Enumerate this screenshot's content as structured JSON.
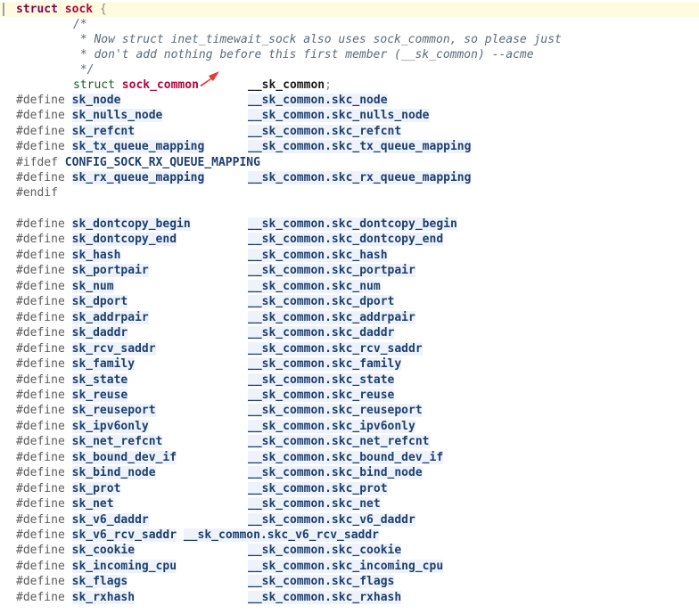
{
  "struct_line": {
    "keyword": "struct",
    "name": "sock",
    "brace": "{"
  },
  "comment_lines": [
    "/*",
    " * Now struct inet_timewait_sock also uses sock_common, so please just",
    " * don't add nothing before this first member (__sk_common) --acme",
    " */"
  ],
  "member": {
    "keyword": "struct",
    "type": "sock_common",
    "name": "__sk_common",
    "semi": ";"
  },
  "group1": [
    {
      "directive": "#define",
      "name": "sk_node",
      "value": "__sk_common.skc_node"
    },
    {
      "directive": "#define",
      "name": "sk_nulls_node",
      "value": "__sk_common.skc_nulls_node"
    },
    {
      "directive": "#define",
      "name": "sk_refcnt",
      "value": "__sk_common.skc_refcnt"
    },
    {
      "directive": "#define",
      "name": "sk_tx_queue_mapping",
      "value": "__sk_common.skc_tx_queue_mapping"
    }
  ],
  "ifdef": {
    "directive": "#ifdef",
    "name": "CONFIG_SOCK_RX_QUEUE_MAPPING"
  },
  "rx_define": {
    "directive": "#define",
    "name": "sk_rx_queue_mapping",
    "value": "__sk_common.skc_rx_queue_mapping"
  },
  "endif": "#endif",
  "group2": [
    {
      "directive": "#define",
      "name": "sk_dontcopy_begin",
      "value": "__sk_common.skc_dontcopy_begin"
    },
    {
      "directive": "#define",
      "name": "sk_dontcopy_end",
      "value": "__sk_common.skc_dontcopy_end"
    },
    {
      "directive": "#define",
      "name": "sk_hash",
      "value": "__sk_common.skc_hash"
    },
    {
      "directive": "#define",
      "name": "sk_portpair",
      "value": "__sk_common.skc_portpair"
    },
    {
      "directive": "#define",
      "name": "sk_num",
      "value": "__sk_common.skc_num"
    },
    {
      "directive": "#define",
      "name": "sk_dport",
      "value": "__sk_common.skc_dport"
    },
    {
      "directive": "#define",
      "name": "sk_addrpair",
      "value": "__sk_common.skc_addrpair"
    },
    {
      "directive": "#define",
      "name": "sk_daddr",
      "value": "__sk_common.skc_daddr"
    },
    {
      "directive": "#define",
      "name": "sk_rcv_saddr",
      "value": "__sk_common.skc_rcv_saddr"
    },
    {
      "directive": "#define",
      "name": "sk_family",
      "value": "__sk_common.skc_family"
    },
    {
      "directive": "#define",
      "name": "sk_state",
      "value": "__sk_common.skc_state"
    },
    {
      "directive": "#define",
      "name": "sk_reuse",
      "value": "__sk_common.skc_reuse"
    },
    {
      "directive": "#define",
      "name": "sk_reuseport",
      "value": "__sk_common.skc_reuseport"
    },
    {
      "directive": "#define",
      "name": "sk_ipv6only",
      "value": "__sk_common.skc_ipv6only"
    },
    {
      "directive": "#define",
      "name": "sk_net_refcnt",
      "value": "__sk_common.skc_net_refcnt"
    },
    {
      "directive": "#define",
      "name": "sk_bound_dev_if",
      "value": "__sk_common.skc_bound_dev_if"
    },
    {
      "directive": "#define",
      "name": "sk_bind_node",
      "value": "__sk_common.skc_bind_node"
    },
    {
      "directive": "#define",
      "name": "sk_prot",
      "value": "__sk_common.skc_prot"
    },
    {
      "directive": "#define",
      "name": "sk_net",
      "value": "__sk_common.skc_net"
    },
    {
      "directive": "#define",
      "name": "sk_v6_daddr",
      "value": "__sk_common.skc_v6_daddr"
    },
    {
      "directive": "#define",
      "name": "sk_v6_rcv_saddr",
      "value": "__sk_common.skc_v6_rcv_saddr",
      "inline": true
    },
    {
      "directive": "#define",
      "name": "sk_cookie",
      "value": "__sk_common.skc_cookie"
    },
    {
      "directive": "#define",
      "name": "sk_incoming_cpu",
      "value": "__sk_common.skc_incoming_cpu"
    },
    {
      "directive": "#define",
      "name": "sk_flags",
      "value": "__sk_common.skc_flags"
    },
    {
      "directive": "#define",
      "name": "sk_rxhash",
      "value": "__sk_common.skc_rxhash"
    }
  ],
  "colors": {
    "current_line": "#fffbdf",
    "annotation_arrow": "#e8382f"
  }
}
